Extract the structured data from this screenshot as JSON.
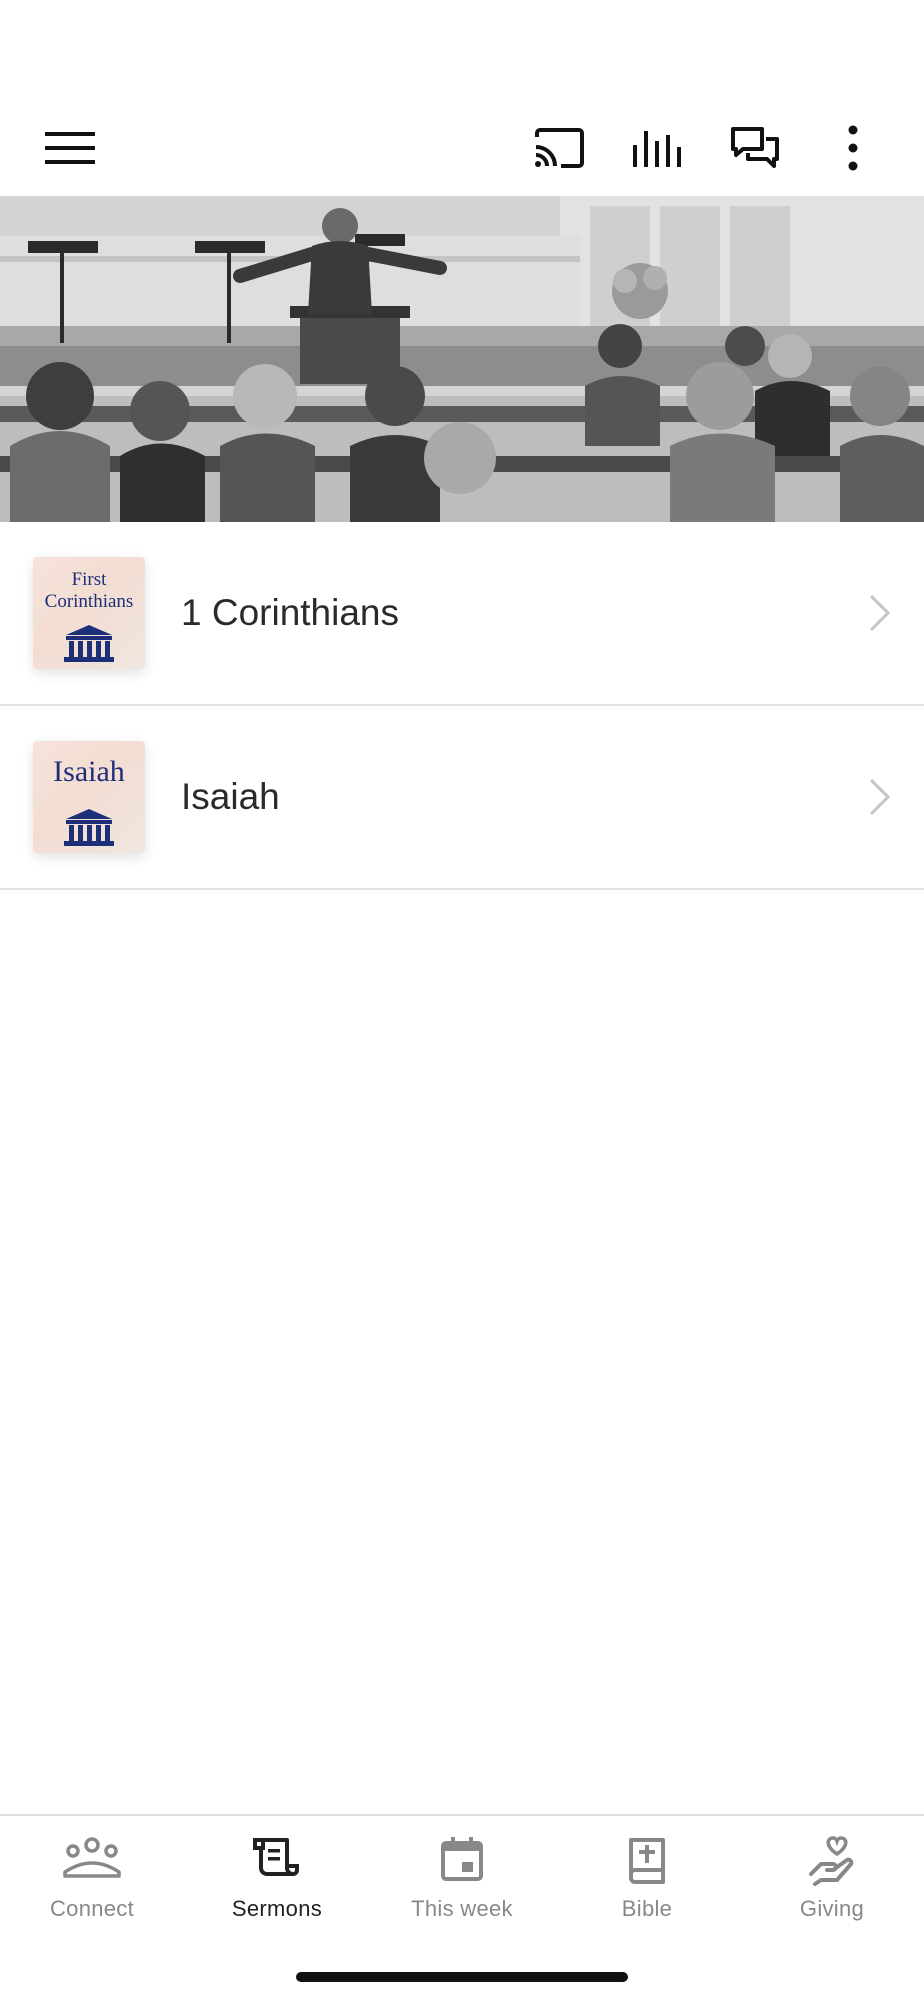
{
  "toolbar": {
    "menu_icon": "hamburger-menu-icon",
    "actions": [
      "cast-icon",
      "audio-levels-icon",
      "chat-icon",
      "more-vertical-icon"
    ]
  },
  "hero": {
    "image": "church-sermon-photo-grayscale"
  },
  "series": [
    {
      "label": "1 Corinthians",
      "thumb_line1": "First",
      "thumb_line2": "Corinthians",
      "icon": "church-building-icon"
    },
    {
      "label": "Isaiah",
      "thumb_line1": "Isaiah",
      "thumb_line2": "",
      "icon": "church-building-icon"
    }
  ],
  "tabs": [
    {
      "label": "Connect",
      "icon": "people-icon",
      "active": false
    },
    {
      "label": "Sermons",
      "icon": "scroll-icon",
      "active": true
    },
    {
      "label": "This week",
      "icon": "calendar-icon",
      "active": false
    },
    {
      "label": "Bible",
      "icon": "bible-icon",
      "active": false
    },
    {
      "label": "Giving",
      "icon": "giving-hand-icon",
      "active": false
    }
  ],
  "colors": {
    "accent_active": "#222222",
    "inactive": "#888888",
    "thumb_text": "#1e2f7a"
  }
}
